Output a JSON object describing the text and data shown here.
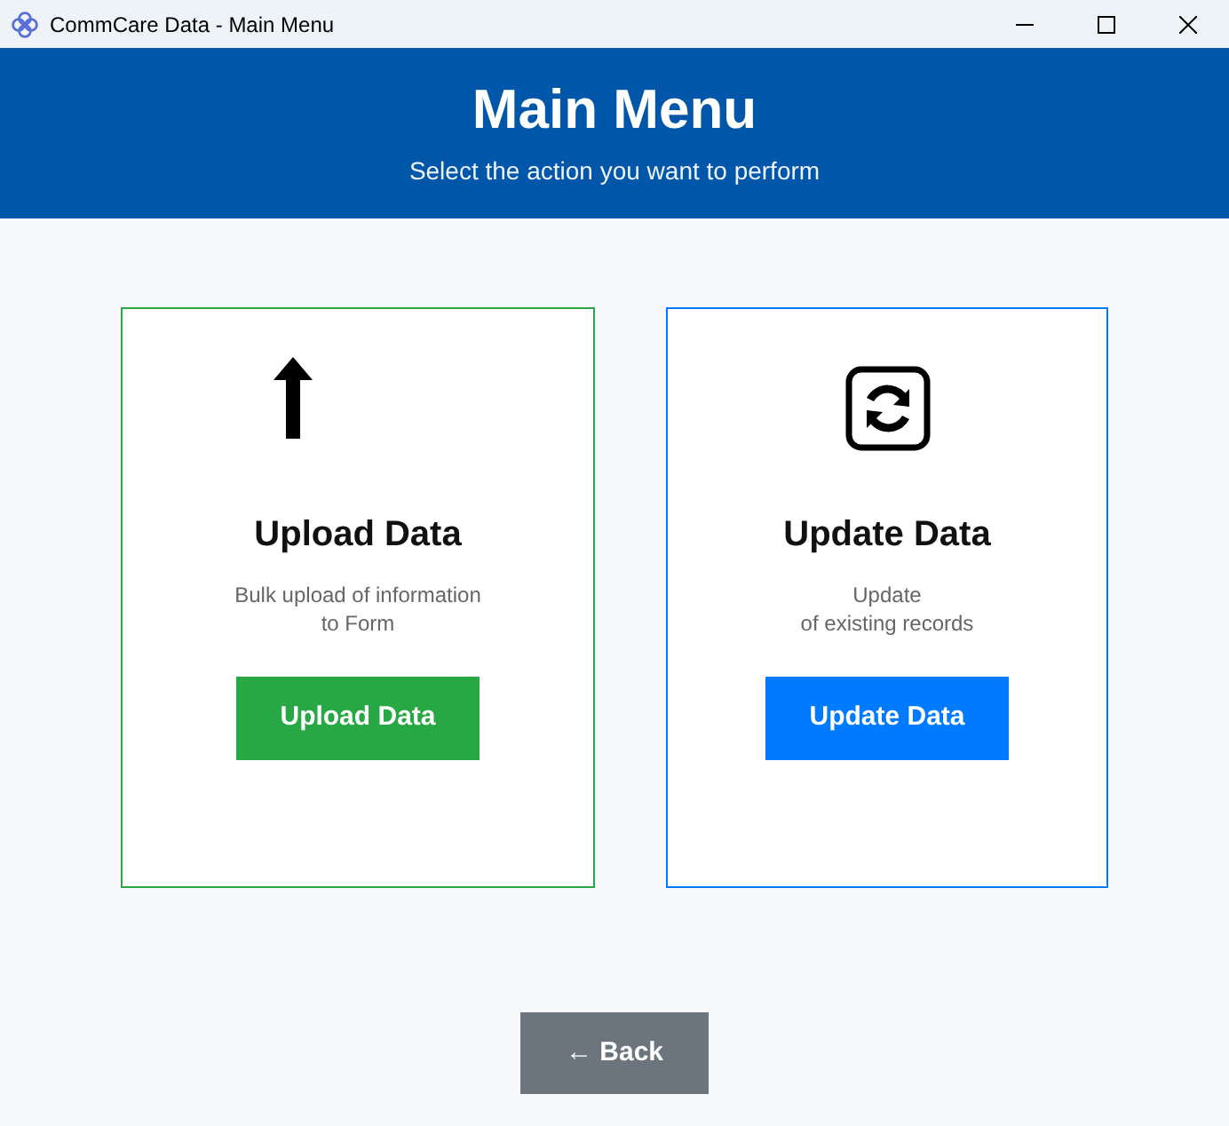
{
  "window": {
    "title": "CommCare Data - Main Menu"
  },
  "header": {
    "title": "Main Menu",
    "subtitle": "Select the action you want to perform"
  },
  "cards": [
    {
      "kind": "upload",
      "title": "Upload Data",
      "description": [
        "Bulk upload of information",
        "to Form"
      ],
      "button": "Upload Data",
      "color": "#28a745"
    },
    {
      "kind": "update",
      "title": "Update Data",
      "description": [
        "Update",
        "of existing records"
      ],
      "button": "Update Data",
      "color": "#007bff"
    }
  ],
  "back_button": "← Back"
}
